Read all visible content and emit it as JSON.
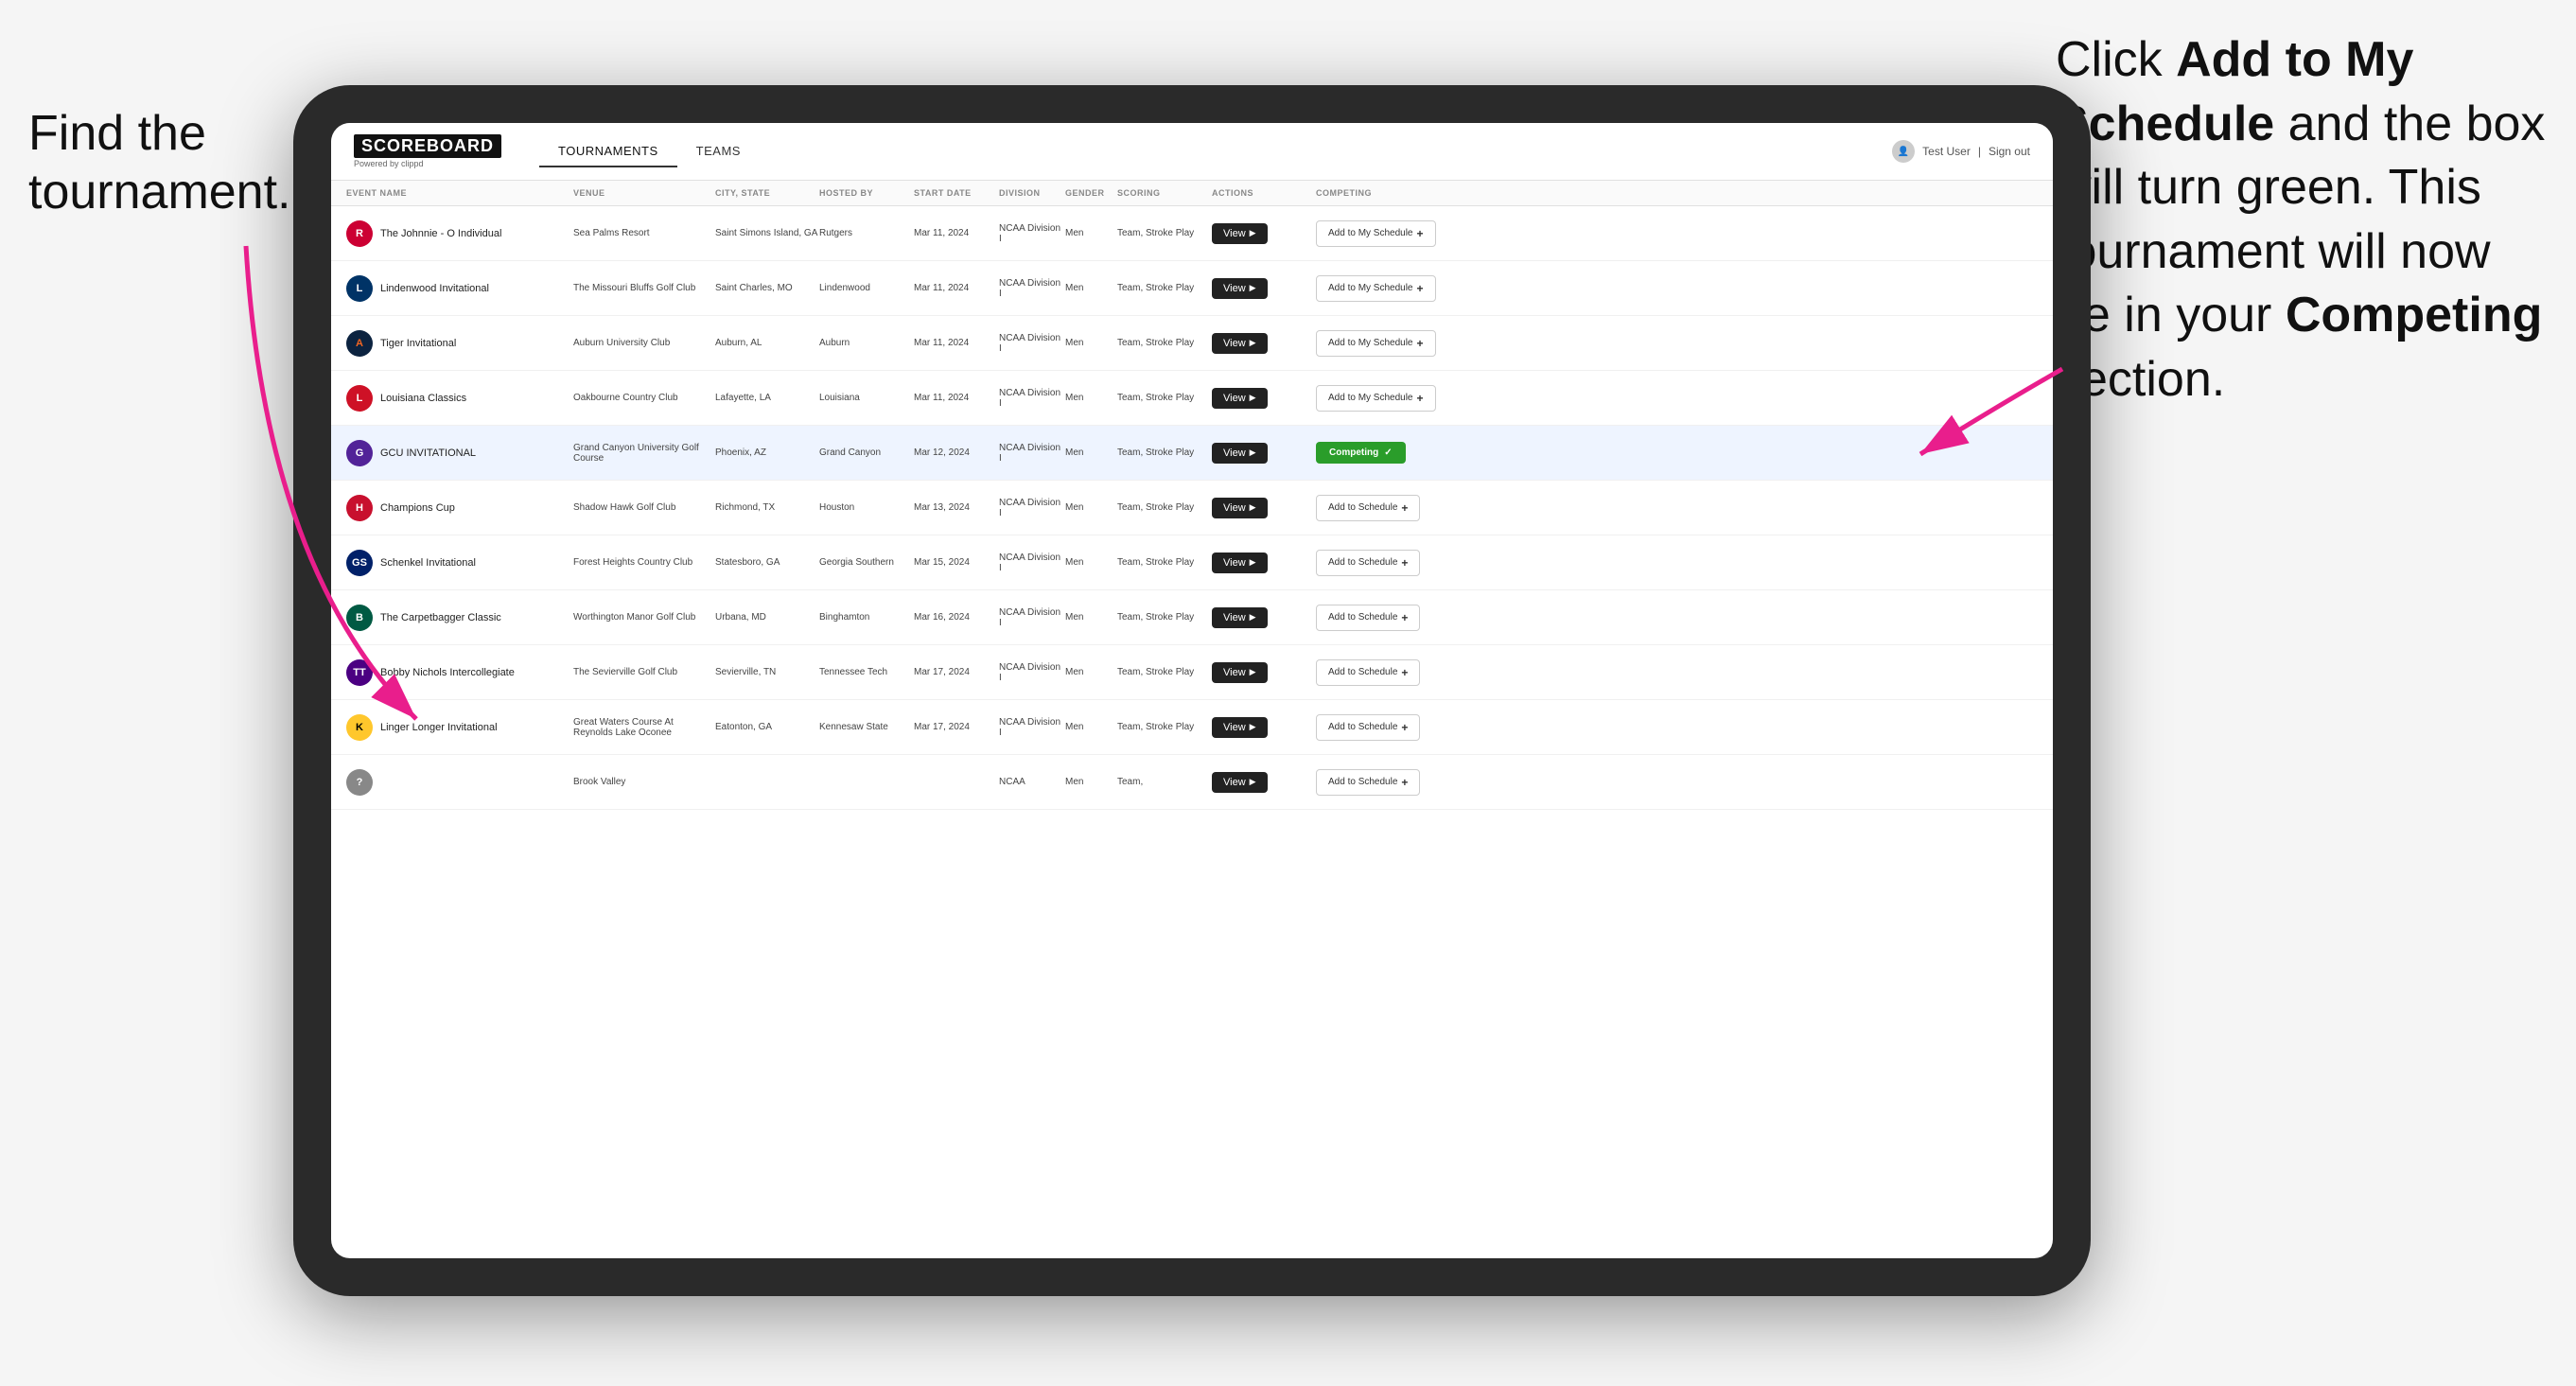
{
  "left_instruction": {
    "line1": "Find the",
    "line2": "tournament."
  },
  "right_instruction": {
    "text_normal": "Click ",
    "text_bold": "Add to My Schedule",
    "text_rest": " and the box will turn green. This tournament will now be in your ",
    "text_bold2": "Competing",
    "text_end": " section."
  },
  "app": {
    "logo": "SCOREBOARD",
    "logo_sub": "Powered by clippd",
    "nav": [
      "TOURNAMENTS",
      "TEAMS"
    ],
    "active_nav": "TOURNAMENTS",
    "user": "Test User",
    "sign_out": "Sign out"
  },
  "table": {
    "columns": [
      "EVENT NAME",
      "VENUE",
      "CITY, STATE",
      "HOSTED BY",
      "START DATE",
      "DIVISION",
      "GENDER",
      "SCORING",
      "ACTIONS",
      "COMPETING"
    ],
    "rows": [
      {
        "logo_class": "logo-rutgers",
        "logo_text": "R",
        "event_name": "The Johnnie - O Individual",
        "venue": "Sea Palms Resort",
        "city_state": "Saint Simons Island, GA",
        "hosted_by": "Rutgers",
        "start_date": "Mar 11, 2024",
        "division": "NCAA Division I",
        "gender": "Men",
        "scoring": "Team, Stroke Play",
        "action_view": "View",
        "competing": "Add to My Schedule",
        "is_competing": false,
        "highlighted": false
      },
      {
        "logo_class": "logo-lindenwood",
        "logo_text": "L",
        "event_name": "Lindenwood Invitational",
        "venue": "The Missouri Bluffs Golf Club",
        "city_state": "Saint Charles, MO",
        "hosted_by": "Lindenwood",
        "start_date": "Mar 11, 2024",
        "division": "NCAA Division I",
        "gender": "Men",
        "scoring": "Team, Stroke Play",
        "action_view": "View",
        "competing": "Add to My Schedule",
        "is_competing": false,
        "highlighted": false
      },
      {
        "logo_class": "logo-auburn",
        "logo_text": "A",
        "event_name": "Tiger Invitational",
        "venue": "Auburn University Club",
        "city_state": "Auburn, AL",
        "hosted_by": "Auburn",
        "start_date": "Mar 11, 2024",
        "division": "NCAA Division I",
        "gender": "Men",
        "scoring": "Team, Stroke Play",
        "action_view": "View",
        "competing": "Add to My Schedule",
        "is_competing": false,
        "highlighted": false
      },
      {
        "logo_class": "logo-louisiana",
        "logo_text": "L",
        "event_name": "Louisiana Classics",
        "venue": "Oakbourne Country Club",
        "city_state": "Lafayette, LA",
        "hosted_by": "Louisiana",
        "start_date": "Mar 11, 2024",
        "division": "NCAA Division I",
        "gender": "Men",
        "scoring": "Team, Stroke Play",
        "action_view": "View",
        "competing": "Add to My Schedule",
        "is_competing": false,
        "highlighted": false
      },
      {
        "logo_class": "logo-gcu",
        "logo_text": "G",
        "event_name": "GCU INVITATIONAL",
        "venue": "Grand Canyon University Golf Course",
        "city_state": "Phoenix, AZ",
        "hosted_by": "Grand Canyon",
        "start_date": "Mar 12, 2024",
        "division": "NCAA Division I",
        "gender": "Men",
        "scoring": "Team, Stroke Play",
        "action_view": "View",
        "competing": "Competing",
        "is_competing": true,
        "highlighted": true
      },
      {
        "logo_class": "logo-houston",
        "logo_text": "H",
        "event_name": "Champions Cup",
        "venue": "Shadow Hawk Golf Club",
        "city_state": "Richmond, TX",
        "hosted_by": "Houston",
        "start_date": "Mar 13, 2024",
        "division": "NCAA Division I",
        "gender": "Men",
        "scoring": "Team, Stroke Play",
        "action_view": "View",
        "competing": "Add to Schedule",
        "is_competing": false,
        "highlighted": false
      },
      {
        "logo_class": "logo-georgia-southern",
        "logo_text": "GS",
        "event_name": "Schenkel Invitational",
        "venue": "Forest Heights Country Club",
        "city_state": "Statesboro, GA",
        "hosted_by": "Georgia Southern",
        "start_date": "Mar 15, 2024",
        "division": "NCAA Division I",
        "gender": "Men",
        "scoring": "Team, Stroke Play",
        "action_view": "View",
        "competing": "Add to Schedule",
        "is_competing": false,
        "highlighted": false
      },
      {
        "logo_class": "logo-binghamton",
        "logo_text": "B",
        "event_name": "The Carpetbagger Classic",
        "venue": "Worthington Manor Golf Club",
        "city_state": "Urbana, MD",
        "hosted_by": "Binghamton",
        "start_date": "Mar 16, 2024",
        "division": "NCAA Division I",
        "gender": "Men",
        "scoring": "Team, Stroke Play",
        "action_view": "View",
        "competing": "Add to Schedule",
        "is_competing": false,
        "highlighted": false
      },
      {
        "logo_class": "logo-tennessee-tech",
        "logo_text": "TT",
        "event_name": "Bobby Nichols Intercollegiate",
        "venue": "The Sevierville Golf Club",
        "city_state": "Sevierville, TN",
        "hosted_by": "Tennessee Tech",
        "start_date": "Mar 17, 2024",
        "division": "NCAA Division I",
        "gender": "Men",
        "scoring": "Team, Stroke Play",
        "action_view": "View",
        "competing": "Add to Schedule",
        "is_competing": false,
        "highlighted": false
      },
      {
        "logo_class": "logo-kennesaw",
        "logo_text": "K",
        "event_name": "Linger Longer Invitational",
        "venue": "Great Waters Course At Reynolds Lake Oconee",
        "city_state": "Eatonton, GA",
        "hosted_by": "Kennesaw State",
        "start_date": "Mar 17, 2024",
        "division": "NCAA Division I",
        "gender": "Men",
        "scoring": "Team, Stroke Play",
        "action_view": "View",
        "competing": "Add to Schedule",
        "is_competing": false,
        "highlighted": false
      },
      {
        "logo_class": "logo-generic",
        "logo_text": "?",
        "event_name": "",
        "venue": "Brook Valley",
        "city_state": "",
        "hosted_by": "",
        "start_date": "",
        "division": "NCAA",
        "gender": "Men",
        "scoring": "Team,",
        "action_view": "View",
        "competing": "Add to Schedule",
        "is_competing": false,
        "highlighted": false
      }
    ]
  }
}
